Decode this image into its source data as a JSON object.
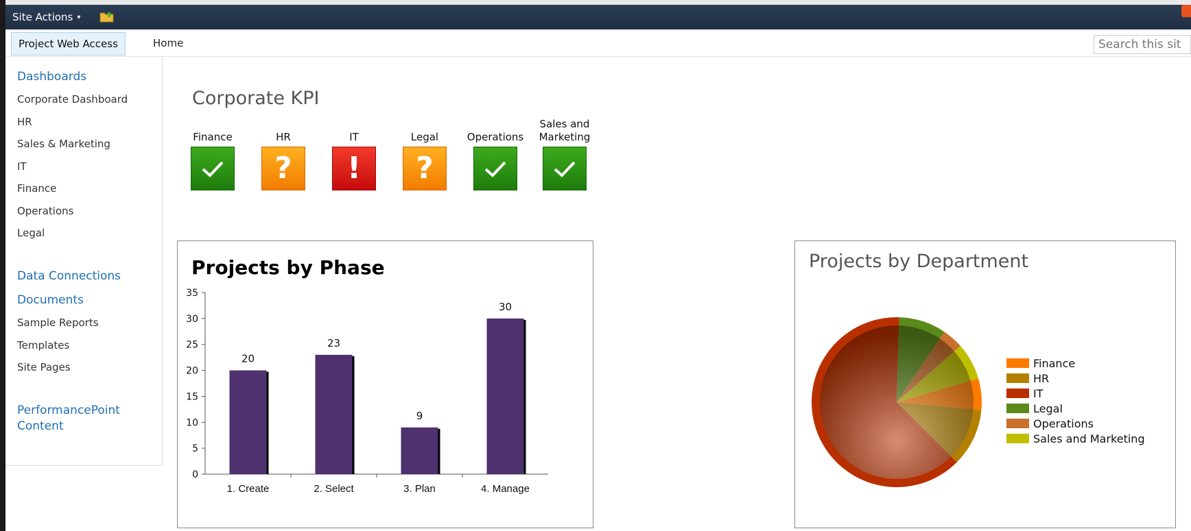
{
  "ribbon": {
    "site_actions_label": "Site Actions",
    "site_actions_caret": "▾",
    "folder_icon": "folder-up-icon",
    "colors": {
      "bar": "#23344a"
    }
  },
  "topnav": {
    "active_tab": "Project Web Access",
    "home_tab": "Home",
    "search_placeholder": "Search this sit"
  },
  "leftnav": {
    "sections": [
      {
        "heading": "Dashboards",
        "items": [
          "Corporate Dashboard",
          "HR",
          "Sales & Marketing",
          "IT",
          "Finance",
          "Operations",
          "Legal"
        ]
      },
      {
        "heading": "Data Connections",
        "items": []
      },
      {
        "heading": "Documents",
        "items": [
          "Sample Reports",
          "Templates",
          "Site Pages"
        ]
      },
      {
        "heading": "PerformancePoint Content",
        "items": []
      }
    ]
  },
  "page_title": "Corporate KPI",
  "kpis": [
    {
      "label": "Finance",
      "status": "good",
      "glyph": "✓",
      "icon": "check-icon",
      "color": "green"
    },
    {
      "label": "HR",
      "status": "warning",
      "glyph": "?",
      "icon": "question-icon",
      "color": "orange"
    },
    {
      "label": "IT",
      "status": "critical",
      "glyph": "!",
      "icon": "exclamation-icon",
      "color": "red"
    },
    {
      "label": "Legal",
      "status": "warning",
      "glyph": "?",
      "icon": "question-icon",
      "color": "orange"
    },
    {
      "label": "Operations",
      "status": "good",
      "glyph": "✓",
      "icon": "check-icon",
      "color": "green"
    },
    {
      "label": "Sales and Marketing",
      "status": "good",
      "glyph": "✓",
      "icon": "check-icon",
      "color": "green"
    }
  ],
  "chart_data": [
    {
      "type": "bar",
      "title": "Projects by Phase",
      "categories": [
        "1. Create",
        "2. Select",
        "3. Plan",
        "4. Manage"
      ],
      "values": [
        20,
        23,
        9,
        30
      ],
      "ylim": [
        0,
        35
      ],
      "yticks": [
        0,
        5,
        10,
        15,
        20,
        25,
        30,
        35
      ],
      "xlabel": "",
      "ylabel": "",
      "grid": false,
      "bar_color": "#4e316e"
    },
    {
      "type": "pie",
      "title": "Projects by Department",
      "labels": [
        "Finance",
        "HR",
        "IT",
        "Legal",
        "Operations",
        "Sales and Marketing"
      ],
      "values": [
        6,
        11,
        63,
        9,
        4,
        7
      ],
      "colors": [
        "#ff7a00",
        "#b38000",
        "#b83000",
        "#5a8a1a",
        "#c8702c",
        "#c0be00"
      ],
      "legend_position": "right"
    }
  ]
}
